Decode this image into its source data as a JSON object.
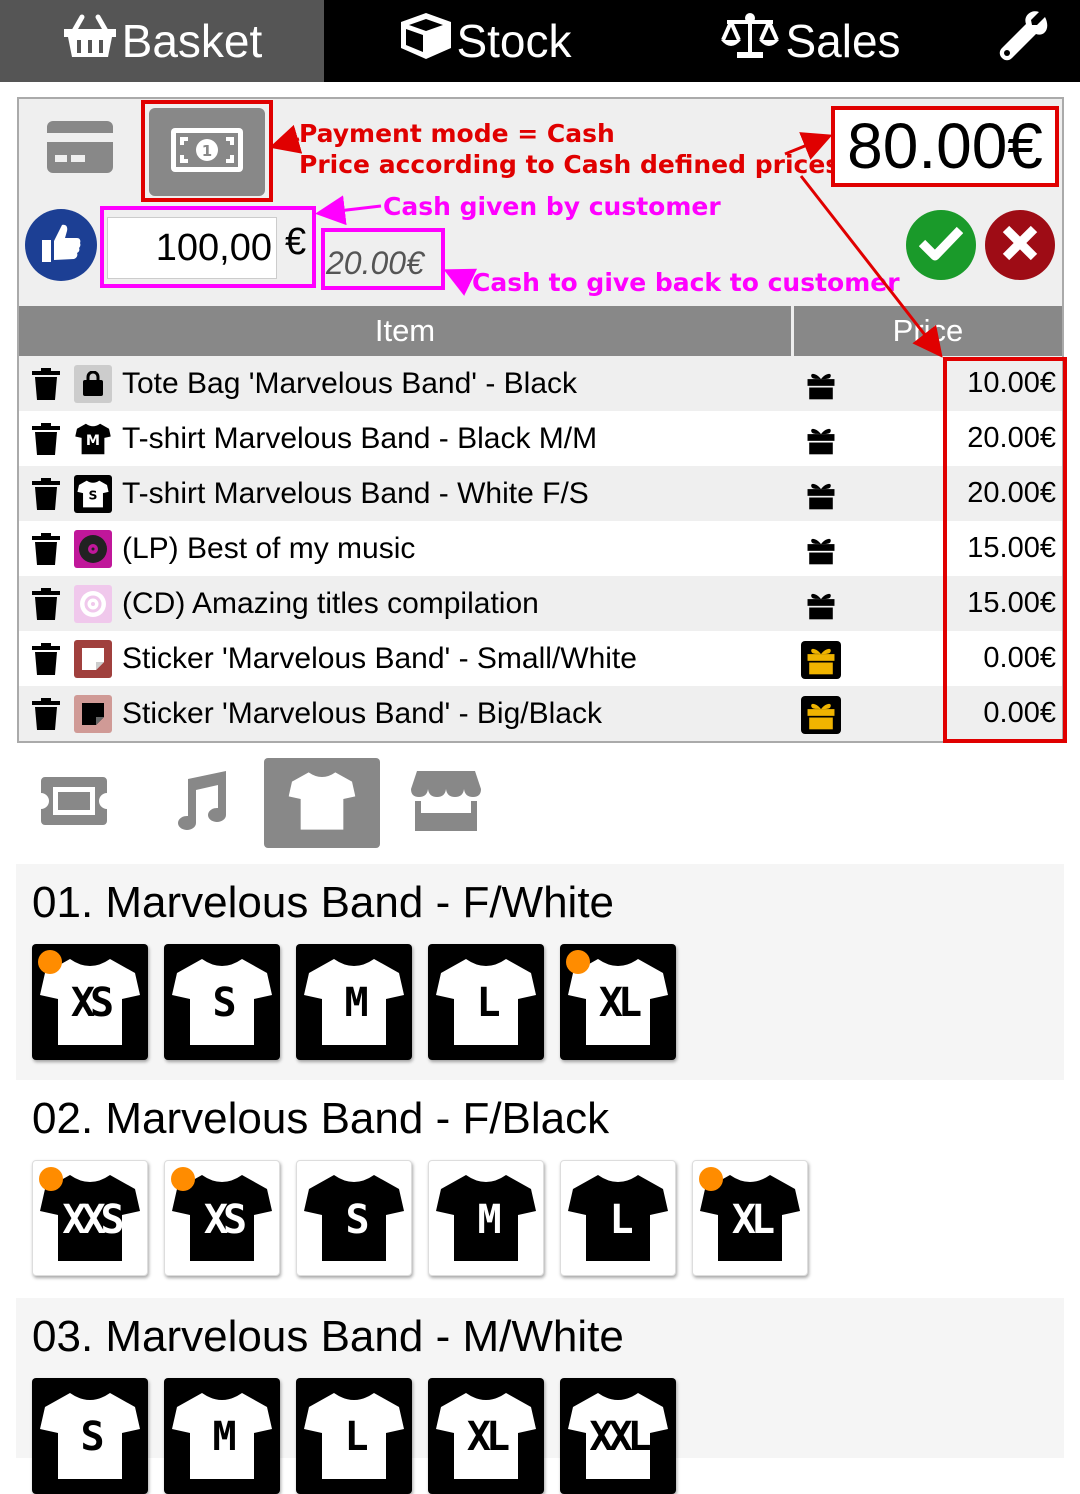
{
  "nav": {
    "tabs": [
      {
        "label": "Basket",
        "icon": "basket-icon",
        "active": true
      },
      {
        "label": "Stock",
        "icon": "box-icon",
        "active": false
      },
      {
        "label": "Sales",
        "icon": "scale-icon",
        "active": false
      }
    ],
    "settings_icon": "wrench-icon"
  },
  "payment": {
    "modes": [
      {
        "icon": "credit-card-icon",
        "selected": false
      },
      {
        "icon": "cash-bill-icon",
        "selected": true
      }
    ],
    "total": "80.00€",
    "cash_given": "100,00",
    "currency": "€",
    "change": "20.00€"
  },
  "annotations": {
    "mode_line1": "Payment mode = Cash",
    "mode_line2": "Price according to Cash defined prices",
    "cash_given": "Cash given by customer",
    "cash_back": "Cash to give back to customer"
  },
  "table": {
    "headers": {
      "item": "Item",
      "price": "Price"
    },
    "rows": [
      {
        "name": "Tote Bag 'Marvelous Band' - Black",
        "icon": "tote-bag-icon",
        "gift": false,
        "price": "10.00€"
      },
      {
        "name": "T-shirt Marvelous Band - Black M/M",
        "icon": "tshirt-black-icon",
        "gift": false,
        "price": "20.00€"
      },
      {
        "name": "T-shirt Marvelous Band - White F/S",
        "icon": "tshirt-white-icon",
        "gift": false,
        "price": "20.00€"
      },
      {
        "name": "(LP) Best of my music",
        "icon": "vinyl-icon",
        "gift": false,
        "price": "15.00€"
      },
      {
        "name": "(CD) Amazing titles compilation",
        "icon": "cd-icon",
        "gift": false,
        "price": "15.00€"
      },
      {
        "name": "Sticker 'Marvelous Band' - Small/White",
        "icon": "sticker-white-icon",
        "gift": true,
        "price": "0.00€"
      },
      {
        "name": "Sticker 'Marvelous Band' - Big/Black",
        "icon": "sticker-black-icon",
        "gift": true,
        "price": "0.00€"
      }
    ]
  },
  "categories": [
    {
      "icon": "ticket-icon",
      "active": false
    },
    {
      "icon": "music-note-icon",
      "active": false
    },
    {
      "icon": "tshirt-icon",
      "active": true
    },
    {
      "icon": "shop-icon",
      "active": false
    }
  ],
  "groups": [
    {
      "title": "01. Marvelous Band - F/White",
      "style": "dark",
      "sizes": [
        {
          "label": "XS",
          "dot": true
        },
        {
          "label": "S",
          "dot": false
        },
        {
          "label": "M",
          "dot": false
        },
        {
          "label": "L",
          "dot": false
        },
        {
          "label": "XL",
          "dot": true
        }
      ]
    },
    {
      "title": "02. Marvelous Band - F/Black",
      "style": "light",
      "sizes": [
        {
          "label": "XXS",
          "dot": true
        },
        {
          "label": "XS",
          "dot": true
        },
        {
          "label": "S",
          "dot": false
        },
        {
          "label": "M",
          "dot": false
        },
        {
          "label": "L",
          "dot": false
        },
        {
          "label": "XL",
          "dot": true
        }
      ]
    },
    {
      "title": "03. Marvelous Band - M/White",
      "style": "dark",
      "sizes": [
        {
          "label": "S",
          "dot": false
        },
        {
          "label": "M",
          "dot": false
        },
        {
          "label": "L",
          "dot": false
        },
        {
          "label": "XL",
          "dot": false
        },
        {
          "label": "XXL",
          "dot": false
        }
      ]
    }
  ],
  "colors": {
    "accent_red": "#e00000",
    "accent_magenta": "#ff00ff",
    "ok_green": "#1a9a2a",
    "cancel_red": "#9e0c15",
    "thumb_blue": "#1c3f94",
    "stock_dot": "#ff8c00"
  }
}
